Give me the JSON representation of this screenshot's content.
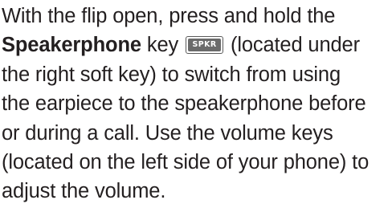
{
  "paragraph": {
    "line1": "With the flip open, press and hold the",
    "line2_bold": "Speakerphone",
    "line2_mid": " key ",
    "key_label": "SPKR",
    "line2_end": " (located under",
    "line3": "the right soft key) to switch from using",
    "line4": "the earpiece to the speakerphone before",
    "line5": "or during a call. Use the volume keys",
    "line6": "(located on the left side of your phone) to",
    "line7": "adjust the volume."
  }
}
